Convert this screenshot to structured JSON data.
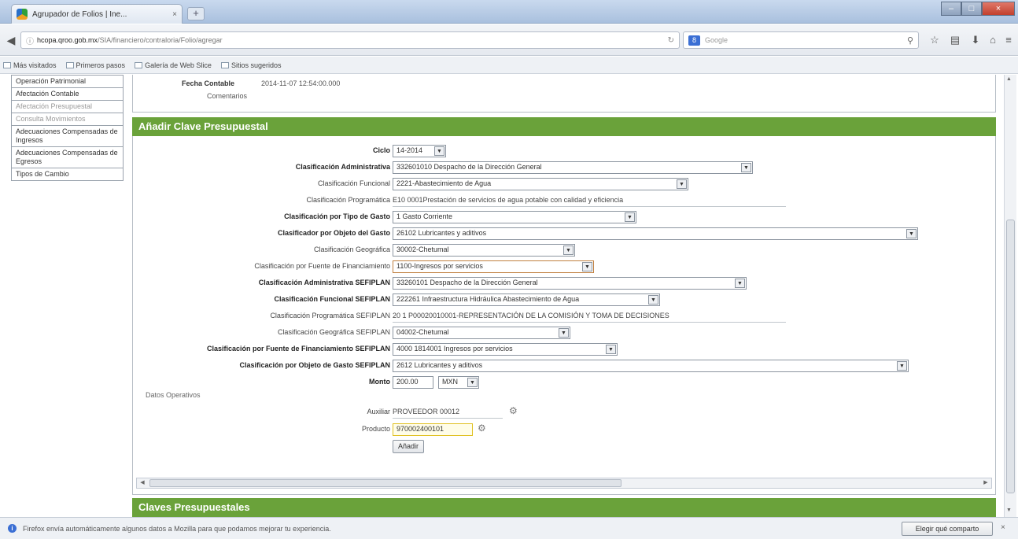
{
  "browser": {
    "tab_title": "Agrupador de Folios | Ine...",
    "tab_close": "×",
    "new_tab": "+",
    "url_host": "hcopa.qroo.gob.mx",
    "url_path": "/SIA/financiero/contraloria/Folio/agregar",
    "search_engine_label": "8",
    "search_placeholder": "Google",
    "window_controls": {
      "minimize": "–",
      "maximize": "□",
      "close": "×"
    }
  },
  "bookmarks": [
    "Más visitados",
    "Primeros pasos",
    "Galería de Web Slice",
    "Sitios sugeridos"
  ],
  "left_menu": [
    {
      "label": "Operación Patrimonial",
      "muted": false
    },
    {
      "label": "Afectación Contable",
      "muted": false
    },
    {
      "label": "Afectación Presupuestal",
      "muted": true
    },
    {
      "label": "Consulta Movimientos",
      "muted": true
    },
    {
      "label": "Adecuaciones Compensadas de Ingresos",
      "muted": false
    },
    {
      "label": "Adecuaciones Compensadas de Egresos",
      "muted": false
    },
    {
      "label": "Tipos de Cambio",
      "muted": false
    }
  ],
  "info": {
    "fecha_label": "Fecha Contable",
    "fecha_value": "2014-11-07 12:54:00.000",
    "comentarios_label": "Comentarios"
  },
  "section_add": {
    "title": "Añadir Clave Presupuestal"
  },
  "section_list": {
    "title": "Claves Presupuestales"
  },
  "form": {
    "ciclo_label": "Ciclo",
    "ciclo_value": "14-2014",
    "c_admin_label": "Clasificación Administrativa",
    "c_admin_value": "332601010 Despacho de la Dirección General",
    "c_func_label": "Clasificación Funcional",
    "c_func_value": "2221-Abastecimiento de Agua",
    "c_prog_label": "Clasificación Programática",
    "c_prog_value": "E10 0001Prestación de servicios de agua potable con calidad y eficiencia",
    "c_tipo_label": "Clasificación por Tipo de Gasto",
    "c_tipo_value": "1 Gasto Corriente",
    "c_obj_label": "Clasificador por Objeto del Gasto",
    "c_obj_value": "26102 Lubricantes y aditivos",
    "c_geo_label": "Clasificación Geográfica",
    "c_geo_value": "30002-Chetumal",
    "c_fuente_label": "Clasificación por Fuente de Financiamiento",
    "c_fuente_value": "1100-Ingresos por servicios",
    "c_admin_s_label": "Clasificación Administrativa SEFIPLAN",
    "c_admin_s_value": "33260101 Despacho de la Dirección General",
    "c_func_s_label": "Clasificación Funcional SEFIPLAN",
    "c_func_s_value": "222261 Infraestructura Hidráulica Abastecimiento de Agua",
    "c_prog_s_label": "Clasificación Programática SEFIPLAN",
    "c_prog_s_value": "20 1 P00020010001-REPRESENTACIÓN DE LA COMISIÓN Y TOMA DE DECISIONES",
    "c_geo_s_label": "Clasificación Geográfica SEFIPLAN",
    "c_geo_s_value": "04002-Chetumal",
    "c_fuente_s_label": "Clasificación por Fuente de Financiamiento SEFIPLAN",
    "c_fuente_s_value": "4000 1814001 Ingresos por servicios",
    "c_obj_s_label": "Clasificación por Objeto de Gasto SEFIPLAN",
    "c_obj_s_value": "2612 Lubricantes y aditivos",
    "monto_label": "Monto",
    "monto_value": "200.00",
    "moneda_value": "MXN",
    "datos_label": "Datos Operativos",
    "auxiliar_label": "Auxiliar",
    "auxiliar_value": "PROVEEDOR 00012",
    "producto_label": "Producto",
    "producto_value": "970002400101",
    "add_button": "Añadir"
  },
  "notification": {
    "text": "Firefox envía automáticamente algunos datos a Mozilla para que podamos mejorar tu experiencia.",
    "button": "Elegir qué comparto",
    "close": "×"
  }
}
